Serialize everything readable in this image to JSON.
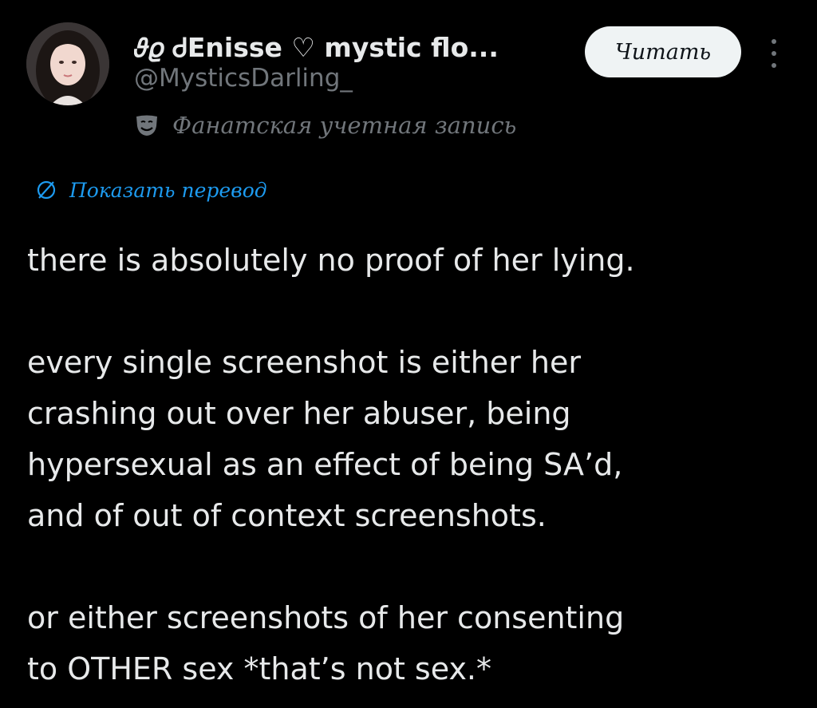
{
  "author": {
    "display_name": "𝜗𝜚 ᏧEnisse ♡ mystic flo...",
    "handle": "@MysticsDarling_",
    "account_label": "Фанатская учетная запись",
    "avatar_icon": "avatar-photo"
  },
  "actions": {
    "follow_label": "Читать",
    "more_icon": "more-vertical-icon"
  },
  "translation": {
    "link_label": "Показать перевод",
    "icon": "globe-icon"
  },
  "tweet": {
    "lines": [
      "there is absolutely no proof of her lying.",
      "",
      "every single screenshot is either her",
      "crashing out over her abuser, being",
      "hypersexual as an effect of being SA’d,",
      "and of out of context screenshots.",
      "",
      "or either screenshots of her consenting",
      "to OTHER sex *that’s not sex.*"
    ]
  },
  "colors": {
    "background": "#000000",
    "text_primary": "#e7e9ea",
    "text_secondary": "#71767b",
    "link_blue": "#1d9bf0",
    "follow_button_bg": "#eff3f4",
    "follow_button_text": "#0f1419"
  }
}
